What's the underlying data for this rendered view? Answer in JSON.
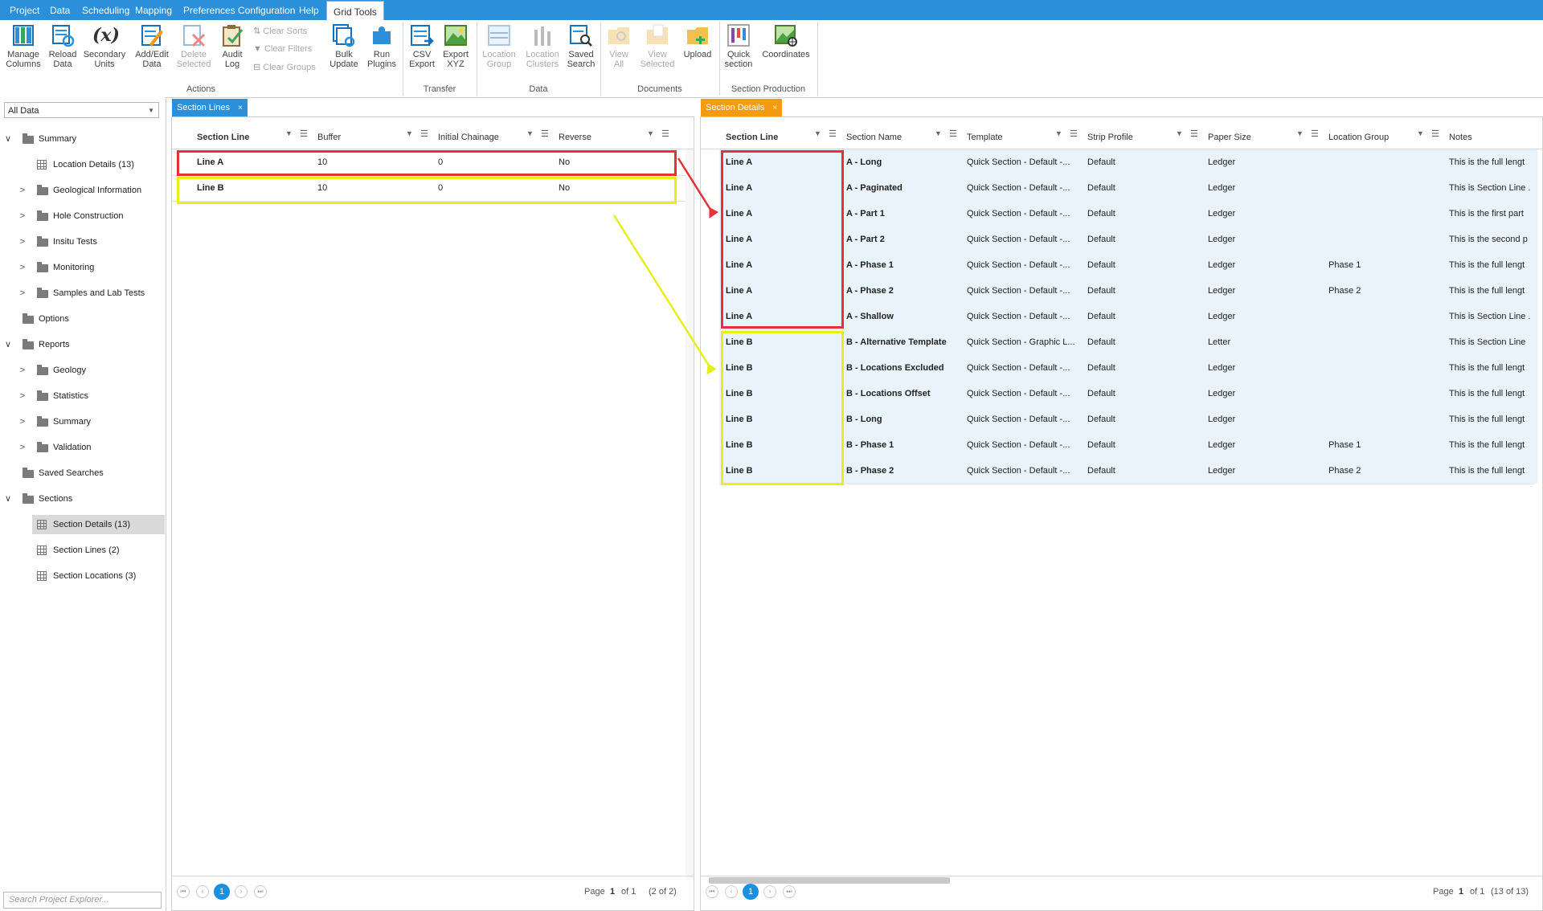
{
  "menu": {
    "items": [
      "Project",
      "Data",
      "Scheduling",
      "Mapping",
      "Preferences",
      "Configuration",
      "Help",
      "Grid Tools"
    ],
    "active": "Grid Tools"
  },
  "ribbon": {
    "buttons": {
      "manage_columns": "Manage Columns",
      "reload_data": "Reload Data",
      "secondary_units": "Secondary Units",
      "add_edit_data": "Add/Edit Data",
      "delete_selected": "Delete Selected",
      "audit_log": "Audit Log",
      "clear_sorts": "Clear Sorts",
      "clear_filters": "Clear Filters",
      "clear_groups": "Clear Groups",
      "bulk_update": "Bulk Update",
      "run_plugins": "Run Plugins",
      "csv_export": "CSV Export",
      "export_xyz": "Export XYZ",
      "location_group": "Location Group",
      "location_clusters": "Location Clusters",
      "saved_search": "Saved Search",
      "view_all": "View All",
      "view_selected": "View Selected",
      "upload": "Upload",
      "quick_section": "Quick section",
      "coordinates": "Coordinates"
    },
    "groups": {
      "actions": "Actions",
      "transfer": "Transfer",
      "data": "Data",
      "documents": "Documents",
      "section_production": "Section Production"
    },
    "icon_names": [
      "columns-icon",
      "reload-icon",
      "secondary-units-icon",
      "edit-data-icon",
      "delete-icon",
      "audit-log-icon",
      "bulk-update-icon",
      "plugins-icon",
      "csv-export-icon",
      "export-xyz-icon",
      "location-group-icon",
      "location-clusters-icon",
      "saved-search-icon",
      "view-all-icon",
      "view-selected-icon",
      "upload-icon",
      "quick-section-icon",
      "coordinates-icon"
    ]
  },
  "sidebar": {
    "dropdown_value": "All Data",
    "search_placeholder": "Search Project Explorer...",
    "tree": [
      {
        "label": "Summary",
        "level": 0,
        "type": "folder",
        "toggle": "expanded"
      },
      {
        "label": "Location Details (13)",
        "level": 1,
        "type": "grid"
      },
      {
        "label": "Geological Information",
        "level": 1,
        "type": "folder",
        "toggle": "collapsed"
      },
      {
        "label": "Hole Construction",
        "level": 1,
        "type": "folder",
        "toggle": "collapsed"
      },
      {
        "label": "Insitu Tests",
        "level": 1,
        "type": "folder",
        "toggle": "collapsed"
      },
      {
        "label": "Monitoring",
        "level": 1,
        "type": "folder",
        "toggle": "collapsed"
      },
      {
        "label": "Samples and Lab Tests",
        "level": 1,
        "type": "folder",
        "toggle": "collapsed"
      },
      {
        "label": "Options",
        "level": 0,
        "type": "folder",
        "toggle": "none"
      },
      {
        "label": "Reports",
        "level": 0,
        "type": "folder",
        "toggle": "expanded"
      },
      {
        "label": "Geology",
        "level": 1,
        "type": "folder",
        "toggle": "collapsed"
      },
      {
        "label": "Statistics",
        "level": 1,
        "type": "folder",
        "toggle": "collapsed"
      },
      {
        "label": "Summary",
        "level": 1,
        "type": "folder",
        "toggle": "collapsed"
      },
      {
        "label": "Validation",
        "level": 1,
        "type": "folder",
        "toggle": "collapsed"
      },
      {
        "label": "Saved Searches",
        "level": 0,
        "type": "folder",
        "toggle": "none"
      },
      {
        "label": "Sections",
        "level": 0,
        "type": "folder",
        "toggle": "expanded"
      },
      {
        "label": "Section Details (13)",
        "level": 1,
        "type": "grid",
        "selected": true
      },
      {
        "label": "Section Lines (2)",
        "level": 1,
        "type": "grid"
      },
      {
        "label": "Section Locations (3)",
        "level": 1,
        "type": "grid"
      }
    ]
  },
  "section_lines": {
    "tab": "Section Lines",
    "tab_close": "×",
    "columns": [
      "Section Line",
      "Buffer",
      "Initial Chainage",
      "Reverse"
    ],
    "rows": [
      [
        "Line A",
        "10",
        "0",
        "No"
      ],
      [
        "Line B",
        "10",
        "0",
        "No"
      ]
    ],
    "pager": {
      "page_label": "Page",
      "page": "1",
      "of": "of 1",
      "count": "(2 of 2)"
    }
  },
  "section_details": {
    "tab": "Section Details",
    "tab_close": "×",
    "columns": [
      "Section Line",
      "Section Name",
      "Template",
      "Strip Profile",
      "Paper Size",
      "Location Group",
      "Notes"
    ],
    "rows": [
      [
        "Line A",
        "A - Long",
        "Quick Section - Default -...",
        "Default",
        "Ledger",
        "",
        "This is the full lengt"
      ],
      [
        "Line A",
        "A - Paginated",
        "Quick Section - Default -...",
        "Default",
        "Ledger",
        "",
        "This is Section Line ."
      ],
      [
        "Line A",
        "A - Part 1",
        "Quick Section - Default -...",
        "Default",
        "Ledger",
        "",
        "This is the first part"
      ],
      [
        "Line A",
        "A - Part 2",
        "Quick Section - Default -...",
        "Default",
        "Ledger",
        "",
        "This is the second p"
      ],
      [
        "Line A",
        "A - Phase 1",
        "Quick Section - Default -...",
        "Default",
        "Ledger",
        "Phase 1",
        "This is the full lengt"
      ],
      [
        "Line A",
        "A - Phase 2",
        "Quick Section - Default -...",
        "Default",
        "Ledger",
        "Phase 2",
        "This is the full lengt"
      ],
      [
        "Line A",
        "A - Shallow",
        "Quick Section - Default -...",
        "Default",
        "Ledger",
        "",
        "This is Section Line ."
      ],
      [
        "Line B",
        "B - Alternative Template",
        "Quick Section - Graphic L...",
        "Default",
        "Letter",
        "",
        "This is Section Line"
      ],
      [
        "Line B",
        "B - Locations Excluded",
        "Quick Section - Default -...",
        "Default",
        "Ledger",
        "",
        "This is the full lengt"
      ],
      [
        "Line B",
        "B - Locations Offset",
        "Quick Section - Default -...",
        "Default",
        "Ledger",
        "",
        "This is the full lengt"
      ],
      [
        "Line B",
        "B - Long",
        "Quick Section - Default -...",
        "Default",
        "Ledger",
        "",
        "This is the full lengt"
      ],
      [
        "Line B",
        "B - Phase 1",
        "Quick Section - Default -...",
        "Default",
        "Ledger",
        "Phase 1",
        "This is the full lengt"
      ],
      [
        "Line B",
        "B - Phase 2",
        "Quick Section - Default -...",
        "Default",
        "Ledger",
        "Phase 2",
        "This is the full lengt"
      ]
    ],
    "pager": {
      "page_label": "Page",
      "page": "1",
      "of": "of 1",
      "count": "(13 of 13)"
    }
  },
  "colors": {
    "menubar": "#2b90d9",
    "section_lines_tab": "#2b90d9",
    "section_details_tab": "#f39c12",
    "highlight_line_a": "#e5323a",
    "highlight_line_b": "#e6ef1a",
    "row_tint": "#e8f3fb"
  }
}
